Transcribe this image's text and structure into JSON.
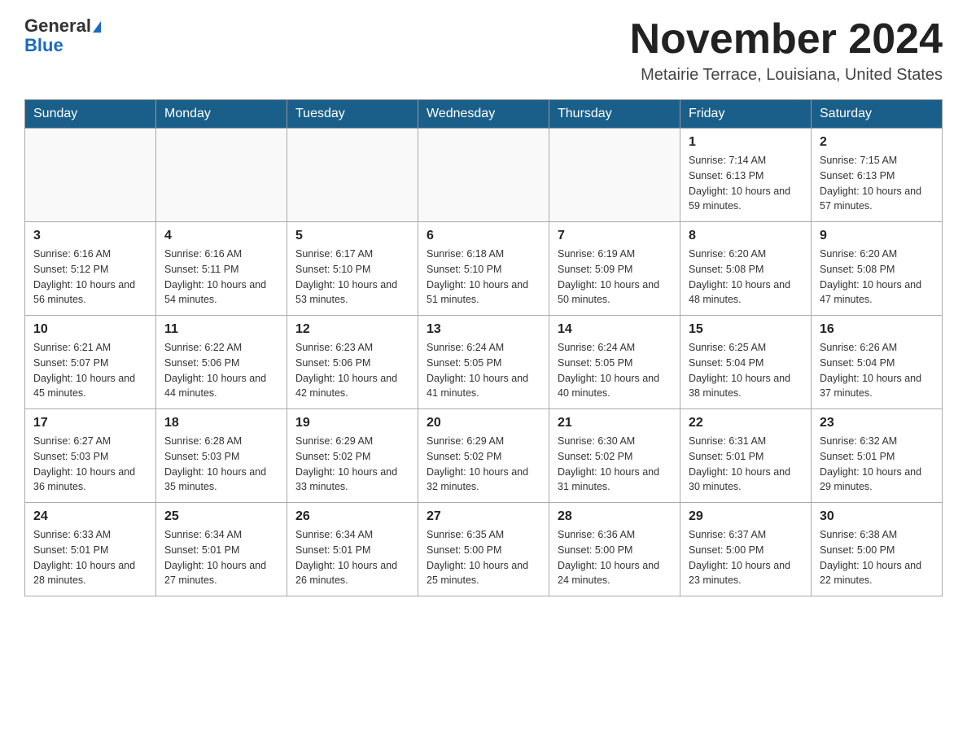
{
  "header": {
    "logo_general": "General",
    "logo_blue": "Blue",
    "month_title": "November 2024",
    "subtitle": "Metairie Terrace, Louisiana, United States"
  },
  "days_of_week": [
    "Sunday",
    "Monday",
    "Tuesday",
    "Wednesday",
    "Thursday",
    "Friday",
    "Saturday"
  ],
  "weeks": [
    [
      {
        "day": "",
        "info": ""
      },
      {
        "day": "",
        "info": ""
      },
      {
        "day": "",
        "info": ""
      },
      {
        "day": "",
        "info": ""
      },
      {
        "day": "",
        "info": ""
      },
      {
        "day": "1",
        "info": "Sunrise: 7:14 AM\nSunset: 6:13 PM\nDaylight: 10 hours and 59 minutes."
      },
      {
        "day": "2",
        "info": "Sunrise: 7:15 AM\nSunset: 6:13 PM\nDaylight: 10 hours and 57 minutes."
      }
    ],
    [
      {
        "day": "3",
        "info": "Sunrise: 6:16 AM\nSunset: 5:12 PM\nDaylight: 10 hours and 56 minutes."
      },
      {
        "day": "4",
        "info": "Sunrise: 6:16 AM\nSunset: 5:11 PM\nDaylight: 10 hours and 54 minutes."
      },
      {
        "day": "5",
        "info": "Sunrise: 6:17 AM\nSunset: 5:10 PM\nDaylight: 10 hours and 53 minutes."
      },
      {
        "day": "6",
        "info": "Sunrise: 6:18 AM\nSunset: 5:10 PM\nDaylight: 10 hours and 51 minutes."
      },
      {
        "day": "7",
        "info": "Sunrise: 6:19 AM\nSunset: 5:09 PM\nDaylight: 10 hours and 50 minutes."
      },
      {
        "day": "8",
        "info": "Sunrise: 6:20 AM\nSunset: 5:08 PM\nDaylight: 10 hours and 48 minutes."
      },
      {
        "day": "9",
        "info": "Sunrise: 6:20 AM\nSunset: 5:08 PM\nDaylight: 10 hours and 47 minutes."
      }
    ],
    [
      {
        "day": "10",
        "info": "Sunrise: 6:21 AM\nSunset: 5:07 PM\nDaylight: 10 hours and 45 minutes."
      },
      {
        "day": "11",
        "info": "Sunrise: 6:22 AM\nSunset: 5:06 PM\nDaylight: 10 hours and 44 minutes."
      },
      {
        "day": "12",
        "info": "Sunrise: 6:23 AM\nSunset: 5:06 PM\nDaylight: 10 hours and 42 minutes."
      },
      {
        "day": "13",
        "info": "Sunrise: 6:24 AM\nSunset: 5:05 PM\nDaylight: 10 hours and 41 minutes."
      },
      {
        "day": "14",
        "info": "Sunrise: 6:24 AM\nSunset: 5:05 PM\nDaylight: 10 hours and 40 minutes."
      },
      {
        "day": "15",
        "info": "Sunrise: 6:25 AM\nSunset: 5:04 PM\nDaylight: 10 hours and 38 minutes."
      },
      {
        "day": "16",
        "info": "Sunrise: 6:26 AM\nSunset: 5:04 PM\nDaylight: 10 hours and 37 minutes."
      }
    ],
    [
      {
        "day": "17",
        "info": "Sunrise: 6:27 AM\nSunset: 5:03 PM\nDaylight: 10 hours and 36 minutes."
      },
      {
        "day": "18",
        "info": "Sunrise: 6:28 AM\nSunset: 5:03 PM\nDaylight: 10 hours and 35 minutes."
      },
      {
        "day": "19",
        "info": "Sunrise: 6:29 AM\nSunset: 5:02 PM\nDaylight: 10 hours and 33 minutes."
      },
      {
        "day": "20",
        "info": "Sunrise: 6:29 AM\nSunset: 5:02 PM\nDaylight: 10 hours and 32 minutes."
      },
      {
        "day": "21",
        "info": "Sunrise: 6:30 AM\nSunset: 5:02 PM\nDaylight: 10 hours and 31 minutes."
      },
      {
        "day": "22",
        "info": "Sunrise: 6:31 AM\nSunset: 5:01 PM\nDaylight: 10 hours and 30 minutes."
      },
      {
        "day": "23",
        "info": "Sunrise: 6:32 AM\nSunset: 5:01 PM\nDaylight: 10 hours and 29 minutes."
      }
    ],
    [
      {
        "day": "24",
        "info": "Sunrise: 6:33 AM\nSunset: 5:01 PM\nDaylight: 10 hours and 28 minutes."
      },
      {
        "day": "25",
        "info": "Sunrise: 6:34 AM\nSunset: 5:01 PM\nDaylight: 10 hours and 27 minutes."
      },
      {
        "day": "26",
        "info": "Sunrise: 6:34 AM\nSunset: 5:01 PM\nDaylight: 10 hours and 26 minutes."
      },
      {
        "day": "27",
        "info": "Sunrise: 6:35 AM\nSunset: 5:00 PM\nDaylight: 10 hours and 25 minutes."
      },
      {
        "day": "28",
        "info": "Sunrise: 6:36 AM\nSunset: 5:00 PM\nDaylight: 10 hours and 24 minutes."
      },
      {
        "day": "29",
        "info": "Sunrise: 6:37 AM\nSunset: 5:00 PM\nDaylight: 10 hours and 23 minutes."
      },
      {
        "day": "30",
        "info": "Sunrise: 6:38 AM\nSunset: 5:00 PM\nDaylight: 10 hours and 22 minutes."
      }
    ]
  ]
}
